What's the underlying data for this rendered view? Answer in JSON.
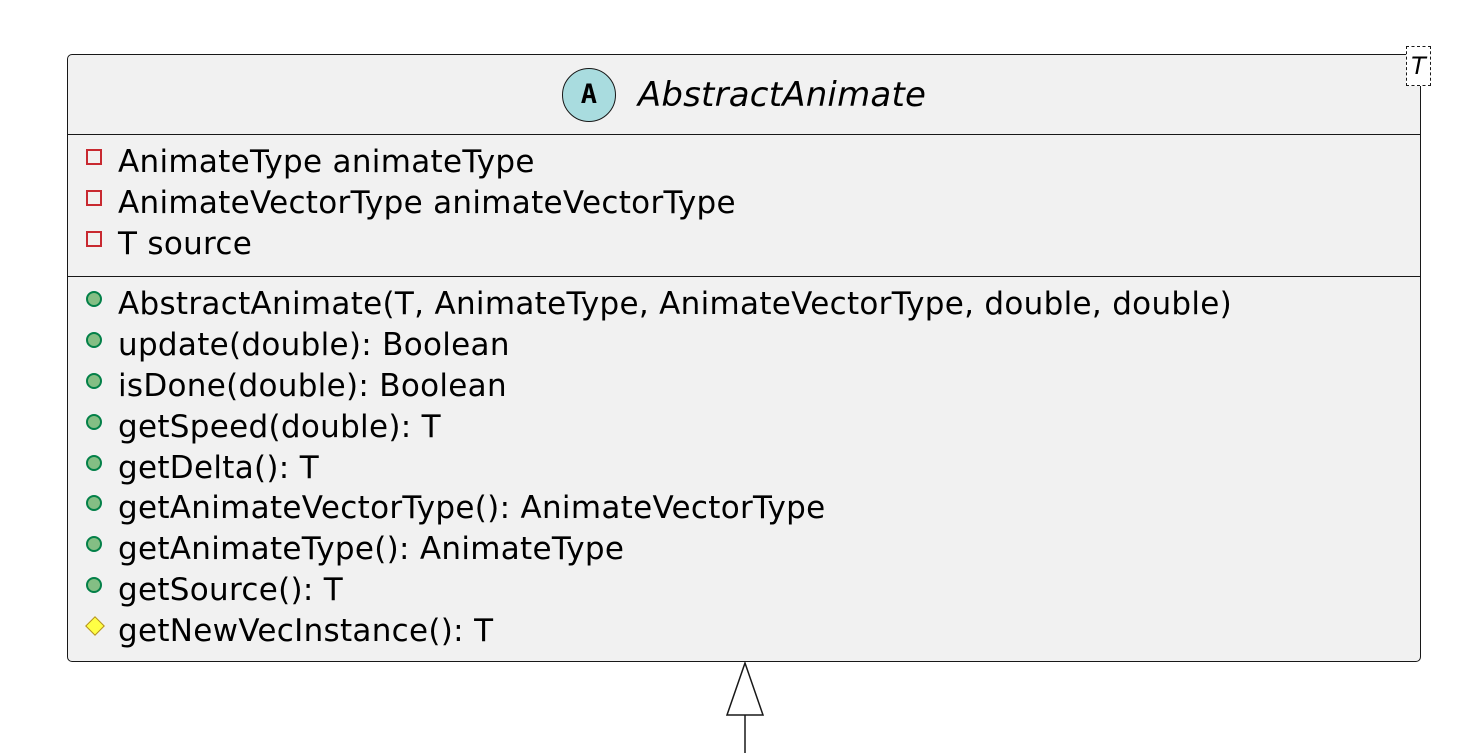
{
  "class": {
    "stereotype_letter": "A",
    "name": "AbstractAnimate",
    "generic_param": "T",
    "fields": [
      {
        "visibility": "private",
        "text": "AnimateType animateType"
      },
      {
        "visibility": "private",
        "text": "AnimateVectorType animateVectorType"
      },
      {
        "visibility": "private",
        "text": "T source"
      }
    ],
    "methods": [
      {
        "visibility": "public",
        "text": "AbstractAnimate(T, AnimateType, AnimateVectorType, double, double)"
      },
      {
        "visibility": "public",
        "text": "update(double): Boolean"
      },
      {
        "visibility": "public",
        "text": "isDone(double): Boolean"
      },
      {
        "visibility": "public",
        "text": "getSpeed(double): T"
      },
      {
        "visibility": "public",
        "text": "getDelta(): T"
      },
      {
        "visibility": "public",
        "text": "getAnimateVectorType(): AnimateVectorType"
      },
      {
        "visibility": "public",
        "text": "getAnimateType(): AnimateType"
      },
      {
        "visibility": "public",
        "text": "getSource(): T"
      },
      {
        "visibility": "protected",
        "text": "getNewVecInstance(): T"
      }
    ]
  },
  "colors": {
    "class_fill": "#f1f1f1",
    "stereotype_fill": "#a9dcdf",
    "private_marker": "#c82930",
    "public_marker": "#84be84",
    "protected_marker": "#ffff44",
    "line": "#181818"
  }
}
